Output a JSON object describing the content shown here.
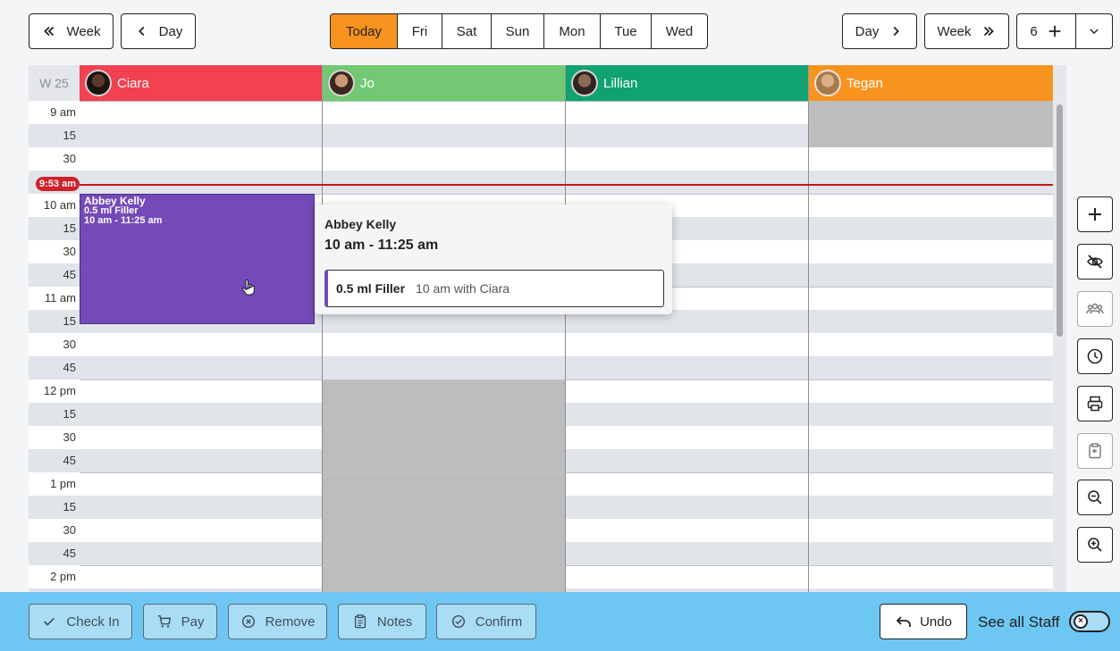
{
  "nav": {
    "week_back": "Week",
    "day_back": "Day",
    "day_forward": "Day",
    "week_forward": "Week",
    "count": "6"
  },
  "days": [
    "Today",
    "Fri",
    "Sat",
    "Sun",
    "Mon",
    "Tue",
    "Wed"
  ],
  "calendar": {
    "week_label": "W 25",
    "staff": [
      {
        "name": "Ciara",
        "color": "#f24150"
      },
      {
        "name": "Jo",
        "color": "#72c873"
      },
      {
        "name": "Lillian",
        "color": "#10a270"
      },
      {
        "name": "Tegan",
        "color": "#f7931e"
      }
    ],
    "times": [
      "9 am",
      "15",
      "30",
      "",
      "10 am",
      "15",
      "30",
      "45",
      "11 am",
      "15",
      "30",
      "45",
      "12 pm",
      "15",
      "30",
      "45",
      "1 pm",
      "15",
      "30",
      "45",
      "2 pm",
      ""
    ],
    "now_label": "9:53 am"
  },
  "appointment": {
    "client": "Abbey Kelly",
    "service": "0.5 ml Filler",
    "time": "10 am - 11:25 am"
  },
  "popover": {
    "client": "Abbey Kelly",
    "time": "10 am - 11:25 am",
    "service": "0.5 ml Filler",
    "detail": "10 am with Ciara"
  },
  "tools": [
    "plus-icon",
    "eye-off-icon",
    "group-icon",
    "clock-icon",
    "printer-icon",
    "clipboard-icon",
    "zoom-out-icon",
    "zoom-in-icon"
  ],
  "actions": {
    "check_in": "Check In",
    "pay": "Pay",
    "remove": "Remove",
    "notes": "Notes",
    "confirm": "Confirm",
    "undo": "Undo",
    "see_all_staff": "See all Staff"
  }
}
